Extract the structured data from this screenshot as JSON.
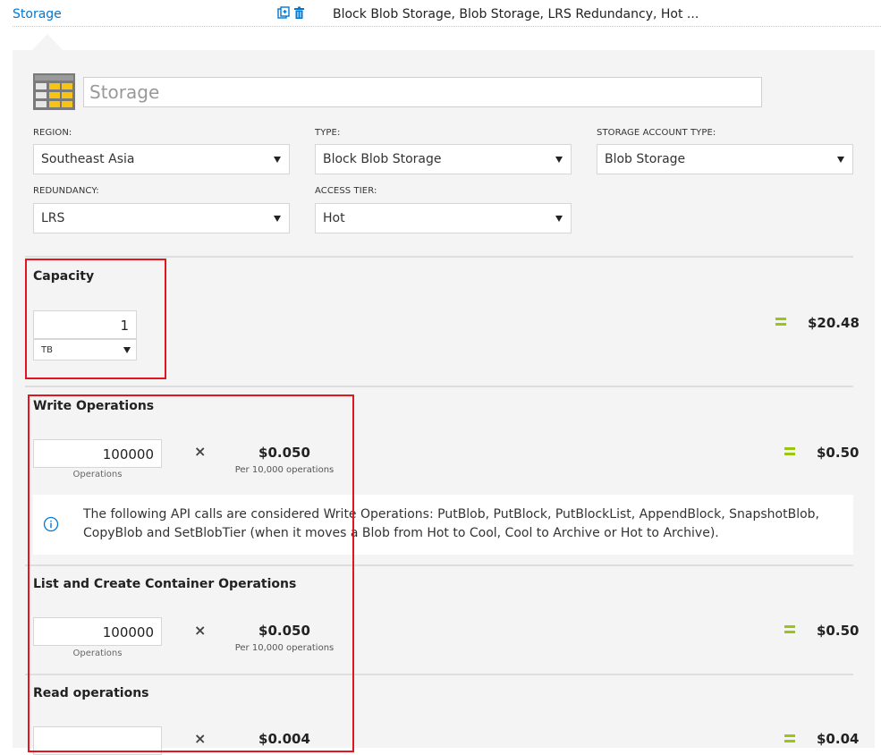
{
  "header": {
    "title": "Storage",
    "summary": "Block Blob Storage, Blob Storage, LRS Redundancy, Hot ...",
    "icons": [
      "duplicate-icon",
      "trash-icon"
    ]
  },
  "panel": {
    "name_placeholder": "Storage",
    "fields": {
      "region": {
        "label": "REGION:",
        "value": "Southeast Asia"
      },
      "type": {
        "label": "TYPE:",
        "value": "Block Blob Storage"
      },
      "account_type": {
        "label": "STORAGE ACCOUNT TYPE:",
        "value": "Blob Storage"
      },
      "redundancy": {
        "label": "REDUNDANCY:",
        "value": "LRS"
      },
      "access_tier": {
        "label": "ACCESS TIER:",
        "value": "Hot"
      }
    },
    "capacity": {
      "title": "Capacity",
      "quantity": "1",
      "unit": "TB",
      "total": "$20.48"
    },
    "write_ops": {
      "title": "Write Operations",
      "quantity": "100000",
      "quantity_label": "Operations",
      "times": "×",
      "price": "$0.050",
      "price_unit": "Per 10,000 operations",
      "total": "$0.50",
      "info": "The following API calls are considered Write Operations: PutBlob, PutBlock, PutBlockList, AppendBlock, SnapshotBlob, CopyBlob and SetBlobTier (when it moves a Blob from Hot to Cool, Cool to Archive or Hot to Archive)."
    },
    "list_ops": {
      "title": "List and Create Container Operations",
      "quantity": "100000",
      "quantity_label": "Operations",
      "times": "×",
      "price": "$0.050",
      "price_unit": "Per 10,000 operations",
      "total": "$0.50"
    },
    "read_ops": {
      "title": "Read operations",
      "times": "×",
      "price": "$0.004",
      "total": "$0.04"
    }
  },
  "colors": {
    "accent": "#0078d4",
    "equals": "#9ac511",
    "highlight": "#e0171f",
    "panel": "#f4f4f4"
  }
}
